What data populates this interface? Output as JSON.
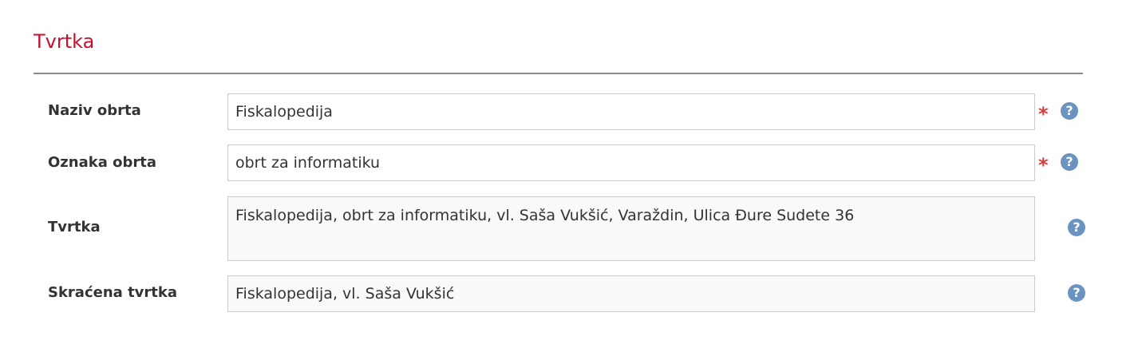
{
  "section": {
    "title": "Tvrtka"
  },
  "fields": [
    {
      "label": "Naziv obrta",
      "value": "Fiskalopedija",
      "required_mark": "*",
      "help": "?"
    },
    {
      "label": "Oznaka obrta",
      "value": "obrt za informatiku",
      "required_mark": "*",
      "help": "?"
    },
    {
      "label": "Tvrtka",
      "value": "Fiskalopedija, obrt za informatiku, vl. Saša Vukšić, Varaždin, Ulica Đure Sudete 36",
      "help": "?"
    },
    {
      "label": "Skraćena tvrtka",
      "value": "Fiskalopedija, vl. Saša Vukšić",
      "help": "?"
    }
  ],
  "colors": {
    "section_title": "#c8102e",
    "required_mark": "#e03a3a",
    "help_icon": "#6b93c0",
    "readonly_background": "#f9f9f9"
  },
  "icons": {
    "help": "question-circle-icon"
  }
}
